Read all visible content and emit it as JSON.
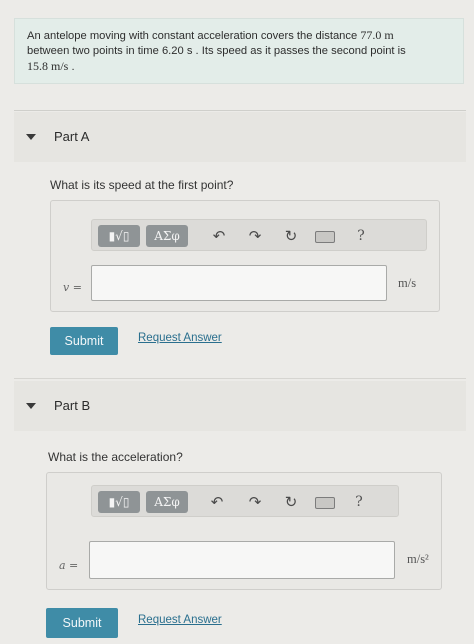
{
  "problem": {
    "text_1": "An antelope moving with constant acceleration covers the distance ",
    "distance": "77.0 m",
    "text_2": "between two points in time 6.20 s . Its speed as it passes the second point is",
    "speed": "15.8 m/s",
    "text_3": " ."
  },
  "part_a": {
    "title": "Part A",
    "question": "What is its speed at the first point?",
    "variable": "v =",
    "unit": "m/s",
    "input_value": "",
    "submit_label": "Submit",
    "request_label": "Request Answer"
  },
  "part_b": {
    "title": "Part B",
    "question": "What is the acceleration?",
    "variable": "a =",
    "unit": "m/s²",
    "input_value": "",
    "submit_label": "Submit",
    "request_label": "Request Answer"
  },
  "toolbar": {
    "templates_label": "▮√▯",
    "symbols_label": "ΑΣφ",
    "help_label": "?"
  },
  "icons": [
    "collapse-triangle-icon",
    "undo-icon",
    "redo-icon",
    "reset-icon",
    "keyboard-icon",
    "help-icon"
  ],
  "colors": {
    "submit": "#3f8ca7",
    "link": "#2a6f8e",
    "problem_bg": "#e3ede9"
  }
}
